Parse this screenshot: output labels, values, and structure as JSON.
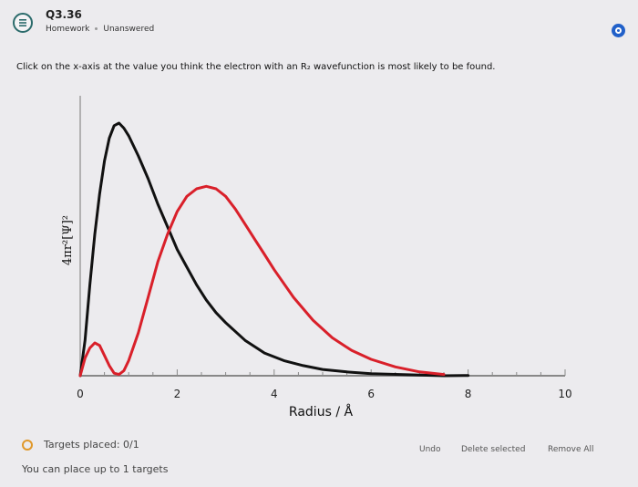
{
  "header": {
    "title": "Q3.36",
    "type": "Homework",
    "status": "Unanswered"
  },
  "prompt": "Click on the x-axis at the value you think the electron with an R₂ wavefunction is most likely to be found.",
  "footer": {
    "targets_placed": "Targets placed: 0/1",
    "targets_limit": "You can place up to 1 targets",
    "undo": "Undo",
    "delete_selected": "Delete selected",
    "remove_all": "Remove All"
  },
  "colors": {
    "curve_black": "#111111",
    "curve_red": "#d9202a",
    "target_ring": "#e0982a",
    "accent_blue": "#2160c9"
  },
  "chart_data": {
    "type": "line",
    "xlabel": "Radius / Å",
    "ylabel": "4πr²[Ψ]²",
    "xlim": [
      0,
      10
    ],
    "ylim": [
      0,
      1
    ],
    "xticks": [
      0,
      2,
      4,
      6,
      8,
      10
    ],
    "grid": false,
    "series": [
      {
        "color": "#111111",
        "points": [
          [
            0,
            0
          ],
          [
            0.1,
            0.14
          ],
          [
            0.2,
            0.36
          ],
          [
            0.3,
            0.56
          ],
          [
            0.4,
            0.72
          ],
          [
            0.5,
            0.85
          ],
          [
            0.6,
            0.94
          ],
          [
            0.7,
            0.99
          ],
          [
            0.8,
            1.0
          ],
          [
            0.9,
            0.98
          ],
          [
            1.0,
            0.95
          ],
          [
            1.2,
            0.87
          ],
          [
            1.4,
            0.78
          ],
          [
            1.6,
            0.68
          ],
          [
            1.8,
            0.59
          ],
          [
            2.0,
            0.5
          ],
          [
            2.2,
            0.43
          ],
          [
            2.4,
            0.36
          ],
          [
            2.6,
            0.3
          ],
          [
            2.8,
            0.25
          ],
          [
            3.0,
            0.21
          ],
          [
            3.4,
            0.14
          ],
          [
            3.8,
            0.09
          ],
          [
            4.2,
            0.06
          ],
          [
            4.6,
            0.04
          ],
          [
            5.0,
            0.025
          ],
          [
            5.5,
            0.015
          ],
          [
            6.0,
            0.008
          ],
          [
            7.0,
            0.003
          ],
          [
            8.0,
            0.001
          ],
          [
            7.5,
            0.0
          ]
        ]
      },
      {
        "color": "#d9202a",
        "points": [
          [
            0,
            0
          ],
          [
            0.1,
            0.07
          ],
          [
            0.2,
            0.11
          ],
          [
            0.3,
            0.13
          ],
          [
            0.4,
            0.12
          ],
          [
            0.5,
            0.08
          ],
          [
            0.6,
            0.04
          ],
          [
            0.7,
            0.01
          ],
          [
            0.8,
            0.005
          ],
          [
            0.9,
            0.02
          ],
          [
            1.0,
            0.06
          ],
          [
            1.2,
            0.17
          ],
          [
            1.4,
            0.31
          ],
          [
            1.6,
            0.45
          ],
          [
            1.8,
            0.56
          ],
          [
            2.0,
            0.65
          ],
          [
            2.2,
            0.71
          ],
          [
            2.4,
            0.74
          ],
          [
            2.6,
            0.75
          ],
          [
            2.8,
            0.74
          ],
          [
            3.0,
            0.71
          ],
          [
            3.2,
            0.66
          ],
          [
            3.4,
            0.6
          ],
          [
            3.6,
            0.54
          ],
          [
            3.8,
            0.48
          ],
          [
            4.0,
            0.42
          ],
          [
            4.4,
            0.31
          ],
          [
            4.8,
            0.22
          ],
          [
            5.2,
            0.15
          ],
          [
            5.6,
            0.1
          ],
          [
            6.0,
            0.065
          ],
          [
            6.5,
            0.035
          ],
          [
            7.0,
            0.015
          ],
          [
            7.5,
            0.005
          ]
        ]
      }
    ]
  }
}
